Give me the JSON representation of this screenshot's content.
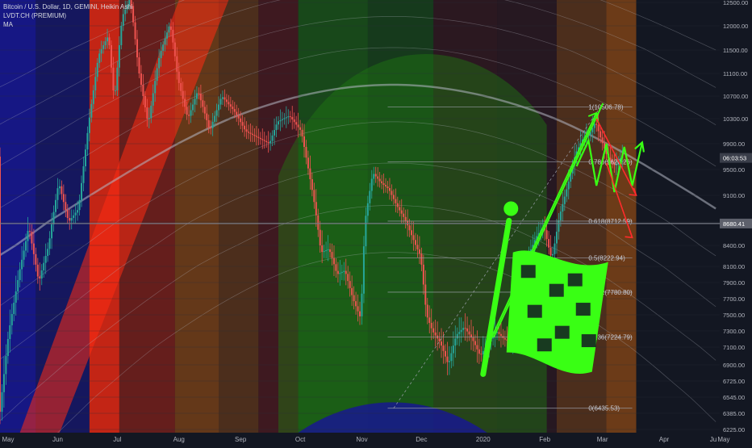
{
  "legend": {
    "symbol": "Bitcoin / U.S. Dollar, 1D, GEMINI, Heikin Ashi",
    "indicator": "LVDT.CH (PREMIUM)",
    "ma": "MA"
  },
  "chart_data": {
    "type": "candlestick",
    "chart_style": "Heikin Ashi",
    "x_axis_labels": [
      "May",
      "Jun",
      "Jul",
      "Aug",
      "Sep",
      "Oct",
      "Nov",
      "Dec",
      "2020",
      "Feb",
      "Mar",
      "Apr",
      "May",
      "Ju"
    ],
    "y_axis_labels": [
      "12500.00",
      "12000.00",
      "11500.00",
      "11100.00",
      "10700.00",
      "10300.00",
      "9900.00",
      "9500.00",
      "9100.00",
      "8700.00",
      "8400.00",
      "8100.00",
      "7900.00",
      "7700.00",
      "7500.00",
      "7300.00",
      "7100.00",
      "6900.00",
      "6725.00",
      "6545.00",
      "6385.00",
      "6225.00"
    ],
    "ylim": [
      6225,
      12500
    ],
    "current_price": "8680.41",
    "countdown": "06:03:53",
    "fib_levels": [
      {
        "label": "1(10506.78)",
        "value": 10506.78
      },
      {
        "label": "0.786(9620.26)",
        "value": 9620.26
      },
      {
        "label": "0.618(8712.59)",
        "value": 8712.59
      },
      {
        "label": "0.5(8222.94)",
        "value": 8222.94
      },
      {
        "label": "0.382(7780.80)",
        "value": 7780.8
      },
      {
        "label": "0.236(7224.79)",
        "value": 7224.79
      },
      {
        "label": "0(6435.53)",
        "value": 6435.53
      }
    ],
    "price_path": [
      [
        0,
        6300
      ],
      [
        5,
        7300
      ],
      [
        10,
        8000
      ],
      [
        15,
        8650
      ],
      [
        20,
        7900
      ],
      [
        25,
        8400
      ],
      [
        30,
        9300
      ],
      [
        35,
        8700
      ],
      [
        40,
        8900
      ],
      [
        45,
        10200
      ],
      [
        50,
        11400
      ],
      [
        55,
        11800
      ],
      [
        58,
        10600
      ],
      [
        62,
        12200
      ],
      [
        66,
        12600
      ],
      [
        70,
        11200
      ],
      [
        75,
        10200
      ],
      [
        80,
        11300
      ],
      [
        86,
        12050
      ],
      [
        90,
        11000
      ],
      [
        95,
        10300
      ],
      [
        100,
        10800
      ],
      [
        106,
        10100
      ],
      [
        112,
        10700
      ],
      [
        118,
        10450
      ],
      [
        124,
        10100
      ],
      [
        130,
        10000
      ],
      [
        136,
        9900
      ],
      [
        140,
        10250
      ],
      [
        146,
        10350
      ],
      [
        152,
        10100
      ],
      [
        158,
        9100
      ],
      [
        162,
        8300
      ],
      [
        166,
        8350
      ],
      [
        170,
        8000
      ],
      [
        174,
        8050
      ],
      [
        178,
        7700
      ],
      [
        182,
        7450
      ],
      [
        184,
        8700
      ],
      [
        188,
        9450
      ],
      [
        192,
        9300
      ],
      [
        196,
        9200
      ],
      [
        200,
        8950
      ],
      [
        204,
        8750
      ],
      [
        208,
        8500
      ],
      [
        212,
        8250
      ],
      [
        215,
        7500
      ],
      [
        218,
        7300
      ],
      [
        222,
        7150
      ],
      [
        226,
        6900
      ],
      [
        230,
        7250
      ],
      [
        234,
        7350
      ],
      [
        238,
        7200
      ],
      [
        242,
        7000
      ],
      [
        246,
        7150
      ],
      [
        250,
        7300
      ],
      [
        254,
        7200
      ],
      [
        258,
        7150
      ],
      [
        262,
        7700
      ],
      [
        266,
        8250
      ],
      [
        270,
        8500
      ],
      [
        274,
        8650
      ],
      [
        278,
        8200
      ],
      [
        282,
        8800
      ],
      [
        286,
        9250
      ],
      [
        290,
        9750
      ],
      [
        294,
        10000
      ],
      [
        297,
        10050
      ],
      [
        300,
        10250
      ],
      [
        303,
        9950
      ],
      [
        306,
        9700
      ],
      [
        310,
        9550
      ],
      [
        313,
        9700
      ]
    ],
    "projections": {
      "green_zigzag": [
        [
          290,
          9550
        ],
        [
          296,
          9950
        ],
        [
          300,
          9250
        ],
        [
          305,
          9900
        ],
        [
          309,
          9150
        ],
        [
          314,
          9850
        ],
        [
          318,
          9250
        ],
        [
          323,
          9920
        ]
      ],
      "red_arrows": [
        {
          "from": [
            300,
            10300
          ],
          "to": [
            320,
            9100
          ]
        },
        {
          "from": [
            305,
            9600
          ],
          "to": [
            318,
            8500
          ]
        }
      ],
      "green_arrow": {
        "from": [
          245,
          7100
        ],
        "to": [
          300,
          10400
        ]
      }
    },
    "colors": {
      "background": "#131722",
      "bull_candle": "#26a69a",
      "bear_candle": "#ef5350",
      "green_annotation": "#39ff14",
      "red_annotation": "#ff2b2b",
      "bands_blue": "#17178f",
      "bands_green": "#1e7a12",
      "bands_orange": "#b65a10",
      "bands_red": "#ff2b12",
      "bands_maroon": "#4a1a20",
      "current_price_tag": "#5d606b"
    },
    "grid": true
  }
}
